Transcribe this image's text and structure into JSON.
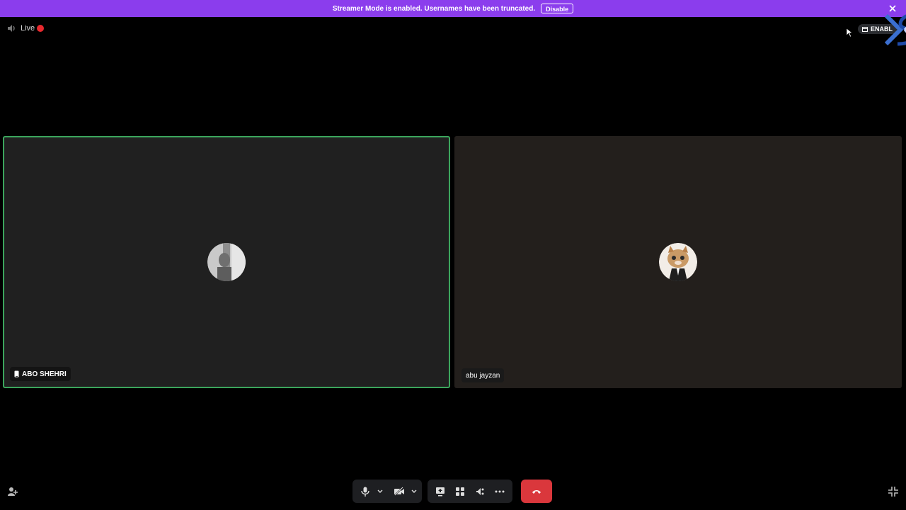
{
  "banner": {
    "message": "Streamer Mode is enabled. Usernames have been truncated.",
    "disable_label": "Disable"
  },
  "status": {
    "live_label": "Live"
  },
  "top_right": {
    "enable_label": "ENABL"
  },
  "participants": [
    {
      "name": "ABO SHEHRI",
      "speaking": true
    },
    {
      "name": "abu jayzan",
      "speaking": false
    }
  ],
  "colors": {
    "banner": "#8b3ded",
    "speaking_border": "#3ba55c",
    "hangup": "#da373c",
    "live_dot": "#e8292e"
  },
  "controls": [
    "microphone-icon",
    "chevron-down-icon",
    "camera-off-icon",
    "chevron-down-icon",
    "screen-share-icon",
    "activities-icon",
    "soundboard-icon",
    "more-icon",
    "hangup-icon"
  ]
}
